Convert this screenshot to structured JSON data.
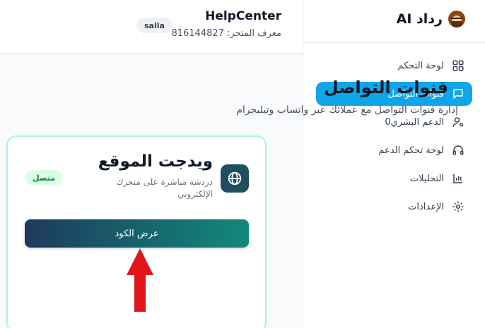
{
  "sidebar": {
    "brand_title": "رداد AI",
    "items": [
      {
        "label": "لوحة التحكم",
        "icon": "grid-icon",
        "active": false
      },
      {
        "label": "قنوات التواصل",
        "icon": "chat-icon",
        "active": true
      },
      {
        "label": "الدعم البشري0",
        "icon": "user-gear-icon",
        "active": false
      },
      {
        "label": "لوحة تحكم الدعم",
        "icon": "headphones-icon",
        "active": false
      },
      {
        "label": "التحليلات",
        "icon": "bar-chart-icon",
        "active": false
      },
      {
        "label": "الإعدادات",
        "icon": "gear-icon",
        "active": false
      }
    ]
  },
  "header": {
    "store_name": "HelpCenter",
    "store_id": "معرف المتجر: 816144827",
    "platform_badge": "salla"
  },
  "main": {
    "title": "قنوات التواصل",
    "subtitle": "إدارة قنوات التواصل مع عملائك عبر واتساب وتيليجرام",
    "channel_card": {
      "title": "ويدجت الموقع",
      "description": "دردشة مباشرة على متجرك الإلكتروني",
      "status": "متصل",
      "button_label": "عرض الكود"
    }
  },
  "colors": {
    "accent": "#0ea5e9",
    "card_border": "#a7f3e4",
    "button_start": "#1e3a5f",
    "button_end": "#12897a",
    "annotation_arrow": "#e0161b"
  }
}
